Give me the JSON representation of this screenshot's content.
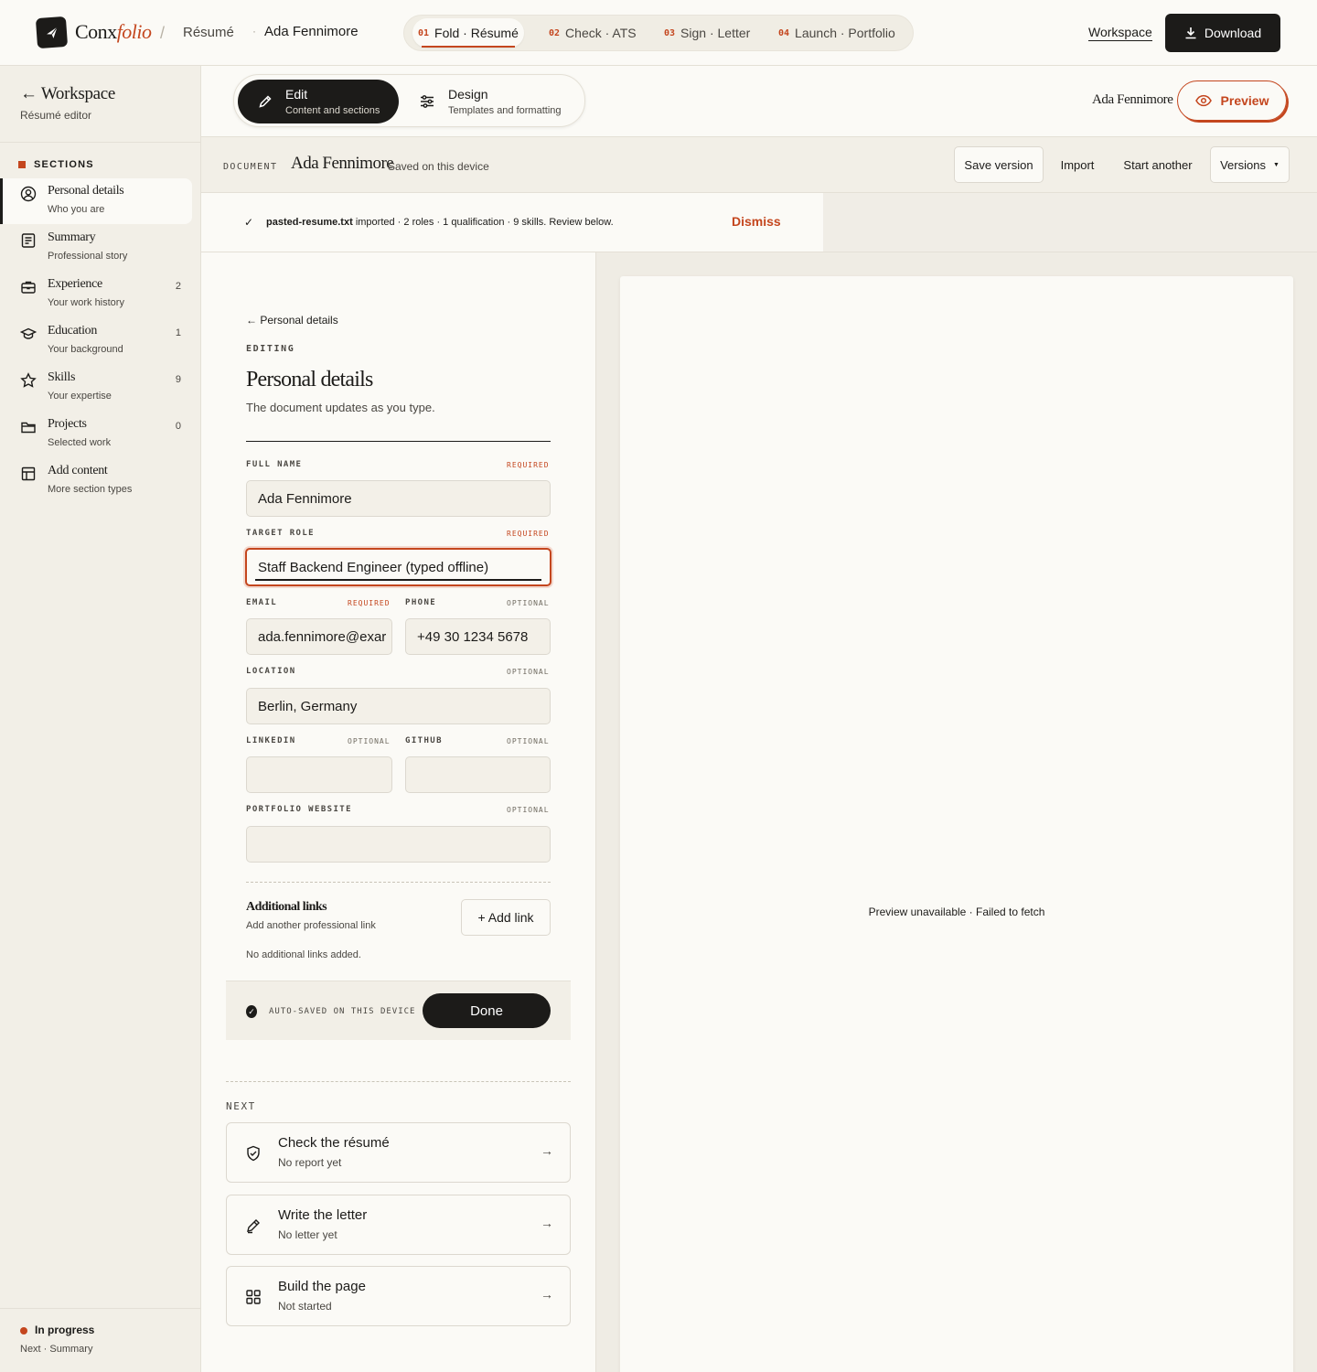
{
  "topbar": {
    "brand_main": "Conx",
    "brand_italic": "folio",
    "crumb_separator": "/",
    "crumb_section": "Résumé",
    "crumb_name": "Ada Fennimore",
    "steps": [
      {
        "num": "01",
        "label": "Fold · Résumé"
      },
      {
        "num": "02",
        "label": "Check · ATS"
      },
      {
        "num": "03",
        "label": "Sign · Letter"
      },
      {
        "num": "04",
        "label": "Launch · Portfolio"
      }
    ],
    "active_step": 0,
    "workspace_link": "Workspace",
    "download_label": "Download"
  },
  "sidebar": {
    "back_label": "Workspace",
    "subtitle": "Résumé editor",
    "sections_heading": "SECTIONS",
    "items": [
      {
        "title": "Personal details",
        "sub": "Who you are",
        "count": "",
        "icon": "user-circle-icon"
      },
      {
        "title": "Summary",
        "sub": "Professional story",
        "count": "",
        "icon": "document-icon"
      },
      {
        "title": "Experience",
        "sub": "Your work history",
        "count": "2",
        "icon": "briefcase-icon"
      },
      {
        "title": "Education",
        "sub": "Your background",
        "count": "1",
        "icon": "graduation-cap-icon"
      },
      {
        "title": "Skills",
        "sub": "Your expertise",
        "count": "9",
        "icon": "star-icon"
      },
      {
        "title": "Projects",
        "sub": "Selected work",
        "count": "0",
        "icon": "folder-icon"
      },
      {
        "title": "Add content",
        "sub": "More section types",
        "count": "",
        "icon": "layout-icon"
      }
    ],
    "status": "In progress",
    "next": "Next · Summary"
  },
  "modebar": {
    "edit_title": "Edit",
    "edit_sub": "Content and sections",
    "design_title": "Design",
    "design_sub": "Templates and formatting",
    "user_name": "Ada Fennimore",
    "preview_label": "Preview"
  },
  "docbar": {
    "label": "DOCUMENT",
    "name": "Ada Fennimore",
    "saved": "Saved on this device",
    "save_version": "Save version",
    "import": "Import",
    "start_another": "Start another",
    "versions": "Versions"
  },
  "notice": {
    "check": "✓",
    "file": "pasted-resume.txt",
    "message": " imported · 2 roles · 1 qualification · 9 skills. Review below.",
    "dismiss": "Dismiss"
  },
  "editor": {
    "back": "Personal details",
    "editing": "EDITING",
    "title": "Personal details",
    "description": "The document updates as you type.",
    "required": "REQUIRED",
    "optional": "OPTIONAL",
    "fields": {
      "full_name": {
        "label": "FULL NAME",
        "value": "Ada Fennimore"
      },
      "target_role": {
        "label": "TARGET ROLE",
        "value": "Staff Backend Engineer (typed offline)"
      },
      "email": {
        "label": "EMAIL",
        "value": "ada.fennimore@exar"
      },
      "phone": {
        "label": "PHONE",
        "value": "+49 30 1234 5678"
      },
      "location": {
        "label": "LOCATION",
        "value": "Berlin, Germany"
      },
      "linkedin": {
        "label": "LINKEDIN",
        "value": ""
      },
      "github": {
        "label": "GITHUB",
        "value": ""
      },
      "portfolio": {
        "label": "PORTFOLIO WEBSITE",
        "value": ""
      }
    },
    "additional_links_title": "Additional links",
    "additional_links_sub": "Add another professional link",
    "add_link": "+ Add link",
    "no_links": "No additional links added.",
    "autosaved": "AUTO-SAVED ON THIS DEVICE",
    "done": "Done",
    "next_label": "NEXT",
    "next_cards": [
      {
        "title": "Check the résumé",
        "sub": "No report yet",
        "icon": "shield-check-icon"
      },
      {
        "title": "Write the letter",
        "sub": "No letter yet",
        "icon": "pen-icon"
      },
      {
        "title": "Build the page",
        "sub": "Not started",
        "icon": "grid-icon"
      }
    ]
  },
  "preview": {
    "message": "Preview unavailable · Failed to fetch"
  },
  "colors": {
    "accent": "#c4461e",
    "ink": "#1c1b19",
    "paper": "#fbfaf6",
    "sidebar": "#f2efe7"
  }
}
